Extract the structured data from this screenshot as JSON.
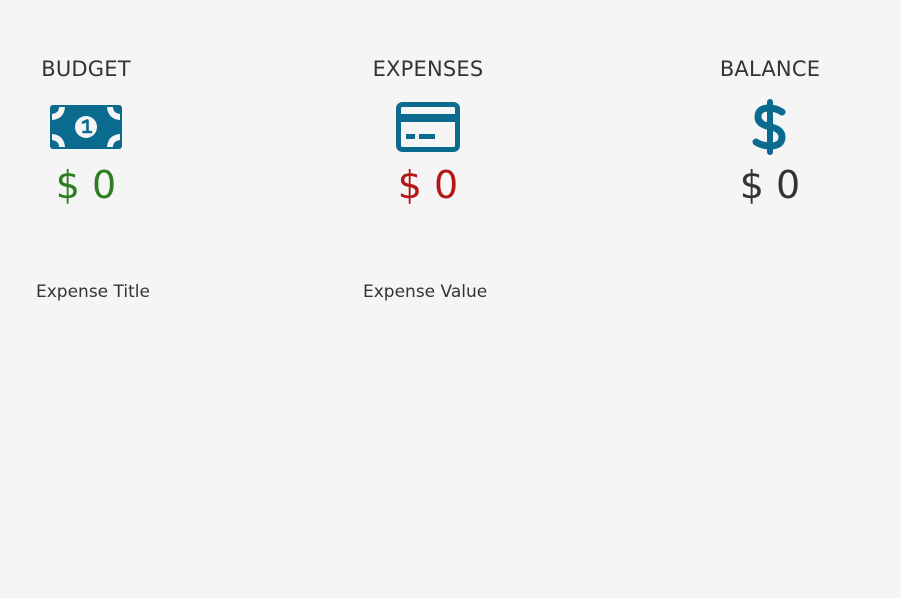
{
  "summary": {
    "budget": {
      "title": "BUDGET",
      "icon": "money-bill-icon",
      "currency": "$",
      "amount": "0",
      "color": "#2e7d22"
    },
    "expenses": {
      "title": "EXPENSES",
      "icon": "credit-card-icon",
      "currency": "$",
      "amount": "0",
      "color": "#b31616"
    },
    "balance": {
      "title": "BALANCE",
      "icon": "dollar-sign-icon",
      "currency": "$",
      "amount": "0",
      "color": "#333333"
    }
  },
  "expense_list": {
    "columns": [
      "Expense Title",
      "Expense Value"
    ]
  },
  "theme": {
    "icon_color": "#0a6b8f",
    "background": "#f5f5f5"
  }
}
